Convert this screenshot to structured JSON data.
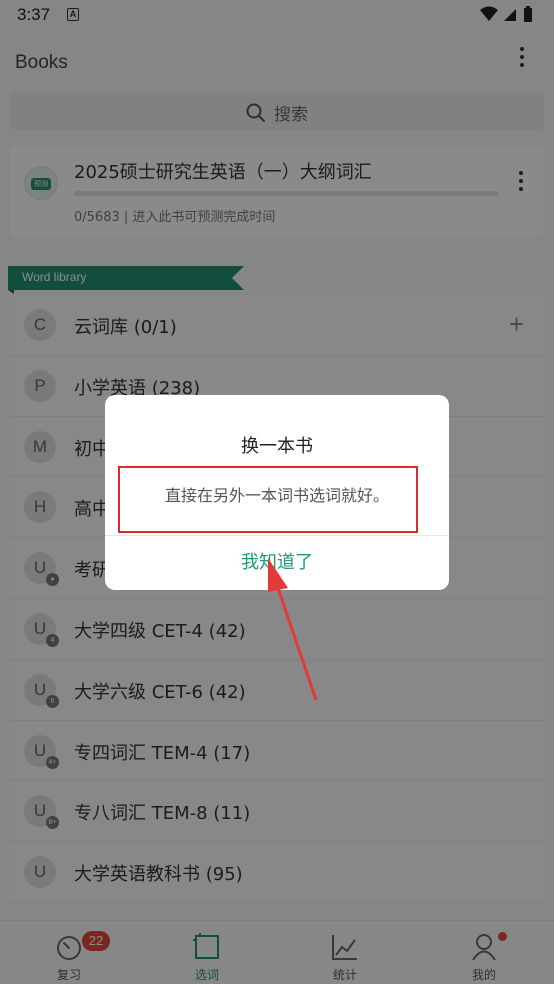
{
  "status_bar": {
    "time": "3:37",
    "notification_letter": "A"
  },
  "header": {
    "title": "Books"
  },
  "search": {
    "label": "搜索"
  },
  "current_book": {
    "badge": "预测",
    "title": "2025硕士研究生英语（一）大纲词汇",
    "stats": "0/5683 | 进入此书可预测完成时间",
    "progress": 0
  },
  "library": {
    "section_label": "Word library",
    "items": [
      {
        "letter": "C",
        "label": "云词库 (0/1)",
        "sub": "",
        "icon": "plus-icon"
      },
      {
        "letter": "P",
        "label": "小学英语 (238)",
        "sub": ""
      },
      {
        "letter": "M",
        "label": "初中",
        "sub": ""
      },
      {
        "letter": "H",
        "label": "高中",
        "sub": ""
      },
      {
        "letter": "U",
        "label": "考研",
        "sub": ""
      },
      {
        "letter": "U",
        "label": "大学四级 CET-4 (42)",
        "sub": "4"
      },
      {
        "letter": "U",
        "label": "大学六级 CET-6 (42)",
        "sub": "6"
      },
      {
        "letter": "U",
        "label": "专四词汇 TEM-4 (17)",
        "sub": "4+"
      },
      {
        "letter": "U",
        "label": "专八词汇 TEM-8 (11)",
        "sub": "8+"
      },
      {
        "letter": "U",
        "label": "大学英语教科书 (95)",
        "sub": ""
      }
    ]
  },
  "bottom_nav": {
    "items": [
      {
        "label": "复习",
        "badge": "22",
        "icon": "review-timer-icon"
      },
      {
        "label": "选词",
        "icon": "book-select-icon",
        "active": true
      },
      {
        "label": "统计",
        "icon": "stats-chart-icon"
      },
      {
        "label": "我的",
        "icon": "profile-icon"
      }
    ]
  },
  "dialog": {
    "title": "换一本书",
    "message": "直接在另外一本词书选词就好。",
    "button": "我知道了"
  },
  "colors": {
    "accent": "#1f9a76",
    "highlight": "#d92b2b",
    "badge": "#e0463a"
  }
}
